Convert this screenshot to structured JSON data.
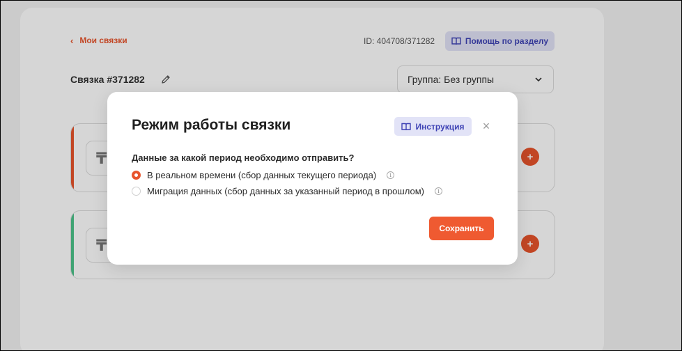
{
  "page": {
    "back_link": "Мои связки",
    "id_text": "ID: 404708/371282",
    "help_button": "Помощь по разделу",
    "title": "Связка #371282",
    "group_select": "Группа: Без группы",
    "step_icon_glyph": "₸",
    "add_glyph": "+"
  },
  "modal": {
    "title": "Режим работы связки",
    "instruction_button": "Инструкция",
    "close_glyph": "×",
    "question": "Данные за какой период необходимо отправить?",
    "options": [
      {
        "label": "В реальном времени (сбор данных текущего периода)",
        "checked": true
      },
      {
        "label": "Миграция данных (сбор данных за указанный период в прошлом)",
        "checked": false
      }
    ],
    "info_glyph": "i",
    "save_button": "Сохранить"
  },
  "colors": {
    "accent": "#e8542c",
    "help_bg": "#e2e3f7",
    "help_text": "#3f43b5",
    "step1_accent": "#e8542c",
    "step2_accent": "#4cc38a"
  }
}
